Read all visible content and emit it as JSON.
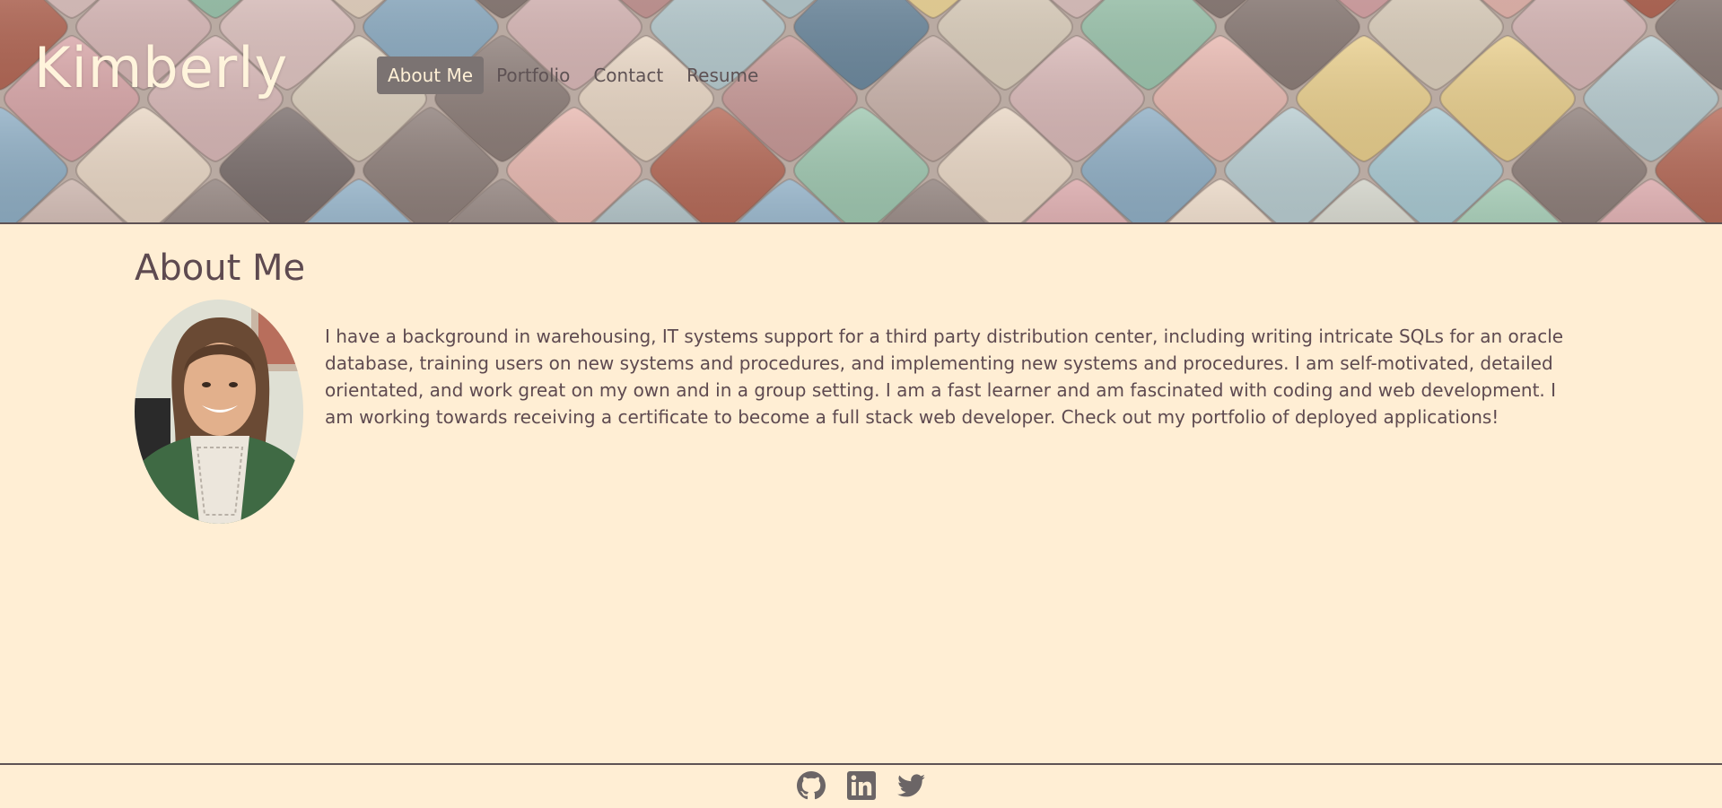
{
  "header": {
    "brand": "Kimberly",
    "nav": [
      {
        "label": "About Me",
        "active": true
      },
      {
        "label": "Portfolio",
        "active": false
      },
      {
        "label": "Contact",
        "active": false
      },
      {
        "label": "Resume",
        "active": false
      }
    ]
  },
  "main": {
    "title": "About Me",
    "bio": "I have a background in warehousing, IT systems support for a third party distribution center, including writing intricate SQLs for an oracle database, training users on new systems and procedures, and implementing new systems and procedures. I am self-motivated, detailed orientated, and work great on my own and in a group setting. I am a fast learner and am fascinated with coding and web development. I am working towards receiving a certificate to become a full stack web developer. Check out my portfolio of deployed applications!"
  },
  "footer": {
    "icons": [
      "github-icon",
      "linkedin-icon",
      "twitter-icon"
    ]
  },
  "colors": {
    "background": "#ffeed4",
    "text": "#5e4a50",
    "nav_active_bg": "#7b7372",
    "brand_text": "#fff4dc"
  }
}
